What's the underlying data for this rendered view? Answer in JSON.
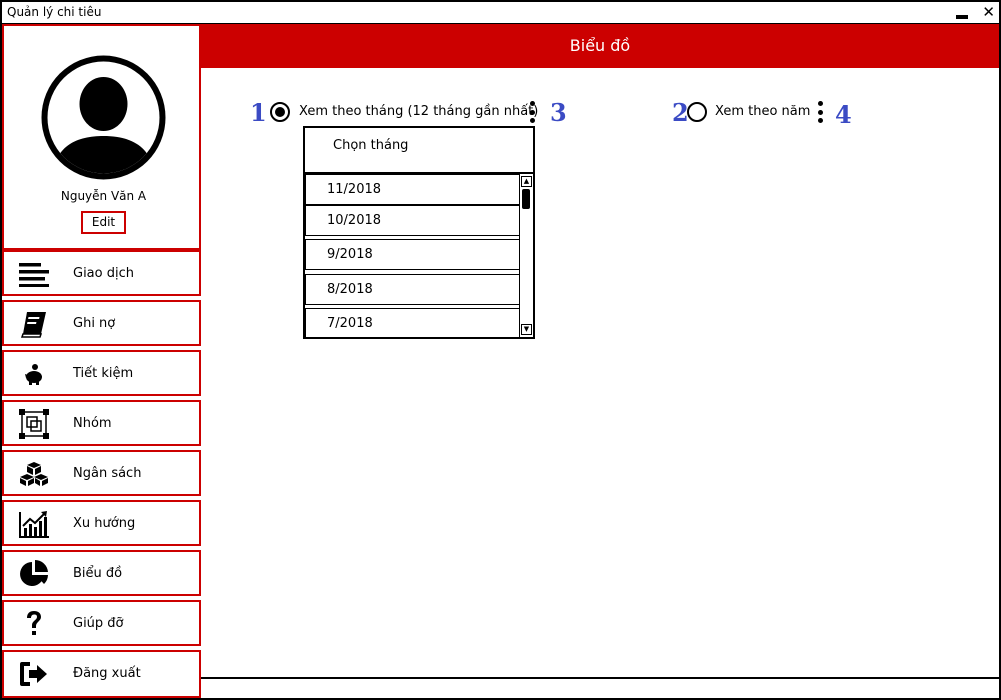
{
  "window": {
    "title": "Quản lý chi tiêu"
  },
  "sidebar": {
    "profile": {
      "name": "Nguyễn Văn A",
      "edit_label": "Edit"
    },
    "items": [
      {
        "label": "Giao dịch",
        "icon": "list-icon"
      },
      {
        "label": "Ghi nợ",
        "icon": "book-icon"
      },
      {
        "label": "Tiết kiệm",
        "icon": "piggy-bank-icon"
      },
      {
        "label": "Nhóm",
        "icon": "group-icon"
      },
      {
        "label": "Ngân sách",
        "icon": "cubes-icon"
      },
      {
        "label": "Xu hướng",
        "icon": "trend-chart-icon"
      },
      {
        "label": "Biểu đồ",
        "icon": "pie-chart-icon"
      },
      {
        "label": "Giúp đỡ",
        "icon": "help-icon"
      },
      {
        "label": "Đăng xuất",
        "icon": "logout-icon"
      }
    ]
  },
  "header": {
    "title": "Biểu đồ"
  },
  "options": {
    "month": {
      "number": "1",
      "label": "Xem theo tháng (12 tháng gần nhất)",
      "menu_number": "3",
      "selected": true
    },
    "year": {
      "number": "2",
      "label": "Xem theo năm",
      "menu_number": "4",
      "selected": false
    }
  },
  "month_dropdown": {
    "title": "Chọn tháng",
    "months": [
      "11/2018",
      "10/2018",
      "9/2018",
      "8/2018",
      "7/2018"
    ]
  },
  "colors": {
    "accent": "#cc0000",
    "annotation": "#3b4bc4"
  }
}
